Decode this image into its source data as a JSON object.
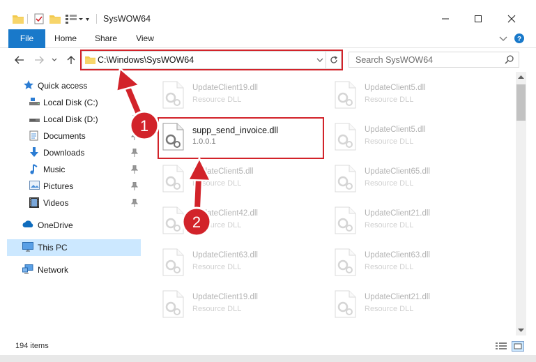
{
  "window": {
    "title": "SysWOW64"
  },
  "ribbon": {
    "tabs": [
      "File",
      "Home",
      "Share",
      "View"
    ]
  },
  "address": {
    "path": "C:\\Windows\\SysWOW64"
  },
  "search": {
    "placeholder": "Search SysWOW64"
  },
  "nav": {
    "items": [
      {
        "label": "Quick access",
        "icon": "star-icon"
      },
      {
        "label": "Local Disk (C:)",
        "icon": "drive-icon"
      },
      {
        "label": "Local Disk (D:)",
        "icon": "drive-icon"
      },
      {
        "label": "Documents",
        "icon": "documents-icon"
      },
      {
        "label": "Downloads",
        "icon": "download-icon"
      },
      {
        "label": "Music",
        "icon": "music-icon"
      },
      {
        "label": "Pictures",
        "icon": "pictures-icon"
      },
      {
        "label": "Videos",
        "icon": "videos-icon"
      },
      {
        "label": "OneDrive",
        "icon": "cloud-icon"
      },
      {
        "label": "This PC",
        "icon": "monitor-icon"
      },
      {
        "label": "Network",
        "icon": "network-icon"
      }
    ],
    "selected": "This PC"
  },
  "files": [
    {
      "name": "UpdateClient19.dll",
      "type": "Resource DLL"
    },
    {
      "name": "UpdateClient5.dll",
      "type": "Resource DLL"
    },
    {
      "name": "supp_send_invoice.dll",
      "type": "1.0.0.1"
    },
    {
      "name": "UpdateClient5.dll",
      "type": "Resource DLL"
    },
    {
      "name": "UpdateClient5.dll",
      "type": "Resource DLL"
    },
    {
      "name": "UpdateClient65.dll",
      "type": "Resource DLL"
    },
    {
      "name": "UpdateClient42.dll",
      "type": "Resource DLL"
    },
    {
      "name": "UpdateClient21.dll",
      "type": "Resource DLL"
    },
    {
      "name": "UpdateClient63.dll",
      "type": "Resource DLL"
    },
    {
      "name": "UpdateClient63.dll",
      "type": "Resource DLL"
    },
    {
      "name": "UpdateClient19.dll",
      "type": "Resource DLL"
    },
    {
      "name": "UpdateClient21.dll",
      "type": "Resource DLL"
    }
  ],
  "status": {
    "item_count": "194 items"
  },
  "annotations": {
    "step1": "1",
    "step2": "2",
    "color": "#d2232a"
  }
}
